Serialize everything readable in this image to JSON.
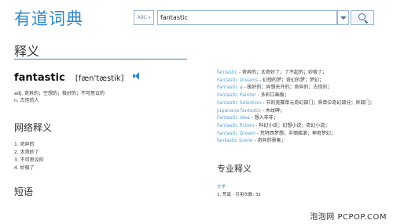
{
  "app": {
    "title": "有道词典"
  },
  "search": {
    "dict_label": "ABC",
    "query": "fantastic"
  },
  "definition": {
    "section_title": "释义",
    "word": "fantastic",
    "phonetic": "[fæn'tæstik]",
    "basic": "adj. 奇异的；空想的；极好的；不可思议的",
    "basic_2": "n. 古怪的人"
  },
  "web": {
    "title": "网络释义",
    "items": [
      "奇异的",
      "太奇妙了",
      "不可思议的",
      "妙极了"
    ]
  },
  "phrases": {
    "title": "短语"
  },
  "related": [
    {
      "term": "fantastic",
      "meaning": " - 奇异的；太奇妙了；了不起的；妙极了；"
    },
    {
      "term": "Fantastic Dreams",
      "meaning": " - 幻想的梦；奇幻的梦；梦幻；"
    },
    {
      "term": "Fantastic a",
      "meaning": " - 极好的；异想天开的；奇异的；古怪的；"
    },
    {
      "term": "Fantastic Painter",
      "meaning": " - 多彩口画板；"
    },
    {
      "term": "Fantastic Selection",
      "meaning": " - 节的竞赛单元奇幻部门；奔单位奇幻部分；异部门；"
    },
    {
      "term": "Jupanana fantastic",
      "meaning": " - 木纹碑；"
    },
    {
      "term": "Fantastic Idea",
      "meaning": " - 想入非非；"
    },
    {
      "term": "Fantastic fiction",
      "meaning": " - 科幻小说；幻想小说；奇幻小说；"
    },
    {
      "term": "Fantastic Dream",
      "meaning": " - 荒特西梦想；半徊摇滚；神奇梦幻；"
    },
    {
      "term": "fantastic scene",
      "meaning": " - 奇异的景象；"
    }
  ],
  "professional": {
    "title": "专业释义",
    "category": "文学",
    "entry": "1. 荒诞 · 引用次数: 32"
  },
  "watermark": "泡泡网 PCPOP.COM"
}
